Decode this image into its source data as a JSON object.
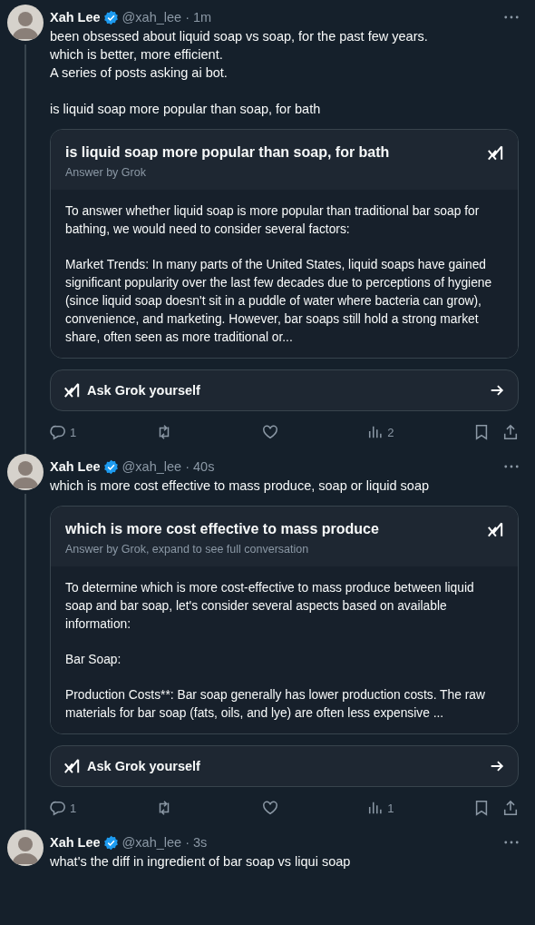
{
  "posts": [
    {
      "author": "Xah Lee",
      "verified": true,
      "handle_time": "@xah_lee · 1m",
      "thread_line": true,
      "text": "been obsessed about liquid soap vs soap, for the past few years.\nwhich is better, more efficient.\nA series of posts asking ai bot.\n\nis liquid soap more popular than soap, for bath",
      "card": {
        "title": "is liquid soap more popular than soap, for bath",
        "subtitle": "Answer by Grok",
        "paragraphs": [
          "To answer whether liquid soap is more popular than traditional bar soap for bathing, we would need to consider several factors:",
          "Market Trends: In many parts of the United States, liquid soaps have gained significant popularity over the last few decades due to perceptions of hygiene (since liquid soap doesn't sit in a puddle of water where bacteria can grow), convenience, and marketing. However, bar soaps still hold a strong market share, often seen as more traditional or..."
        ]
      },
      "ask_button": "Ask Grok yourself",
      "actions": {
        "replies": "1",
        "views": "2"
      }
    },
    {
      "author": "Xah Lee",
      "verified": true,
      "handle_time": "@xah_lee · 40s",
      "thread_line": true,
      "text": "which is more cost effective to mass produce, soap or liquid soap",
      "card": {
        "title": "which is more cost effective to mass produce",
        "subtitle": "Answer by Grok, expand to see full conversation",
        "paragraphs": [
          "To determine which is more cost-effective to mass produce between liquid soap and bar soap, let's consider several aspects based on available information:",
          "Bar Soap:",
          "Production Costs**: Bar soap generally has lower production costs. The raw materials for bar soap (fats, oils, and lye) are often less expensive ..."
        ]
      },
      "ask_button": "Ask Grok yourself",
      "actions": {
        "replies": "1",
        "views": "1"
      }
    },
    {
      "author": "Xah Lee",
      "verified": true,
      "handle_time": "@xah_lee · 3s",
      "text": "what's the diff in ingredient of bar soap vs liqui soap"
    }
  ]
}
